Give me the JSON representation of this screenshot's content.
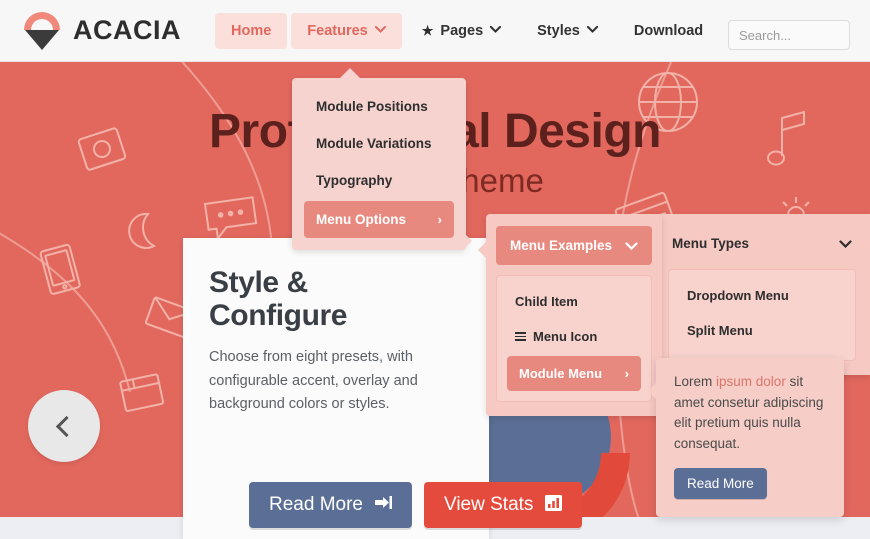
{
  "brand": {
    "name": "ACACIA",
    "logo_icon": "acacia-logo-icon"
  },
  "nav": {
    "items": [
      {
        "label": "Home",
        "icon": null,
        "caret": false,
        "highlight": true
      },
      {
        "label": "Features",
        "icon": null,
        "caret": true,
        "highlight": true
      },
      {
        "label": "Pages",
        "icon": "star-icon",
        "caret": true,
        "highlight": false
      },
      {
        "label": "Styles",
        "icon": null,
        "caret": true,
        "highlight": false
      },
      {
        "label": "Download",
        "icon": null,
        "caret": false,
        "highlight": false
      }
    ],
    "caret_glyph": "❯"
  },
  "search": {
    "placeholder": "Search...",
    "value": ""
  },
  "hero": {
    "title": "Professional Design",
    "subtitle": "Joomla Theme",
    "background_color": "#e2685e",
    "title_color": "#5c211c",
    "prev_arrow_label": "Previous slide",
    "deco_icons": [
      "camera-icon",
      "moon-icon",
      "tablet-icon",
      "chat-bubble-icon",
      "envelope-icon",
      "globe-icon",
      "music-note-icon",
      "sun-icon",
      "credit-card-icon",
      "box-icon"
    ]
  },
  "card": {
    "heading_line1": "Style &",
    "heading_line2": "Configure",
    "body": "Choose from eight presets, with configurable accent, overlay and background colors or styles."
  },
  "hero_buttons": [
    {
      "label": "Read More",
      "icon": "sign-in-icon",
      "glyph": "⮕",
      "color": "#5b6f96"
    },
    {
      "label": "View Stats",
      "icon": "bar-chart-icon",
      "glyph": "Ὄa",
      "color": "#e54b3c"
    }
  ],
  "features_dropdown": {
    "items": [
      {
        "label": "Module Positions",
        "active": false,
        "chevron": false
      },
      {
        "label": "Module Variations",
        "active": false,
        "chevron": false
      },
      {
        "label": "Typography",
        "active": false,
        "chevron": false
      },
      {
        "label": "Menu Options",
        "active": true,
        "chevron": true
      }
    ],
    "chevron_glyph": "›"
  },
  "menu_examples_panel": {
    "header": {
      "label": "Menu Examples",
      "caret": "❯"
    },
    "items": [
      {
        "label": "Child Item",
        "icon": null,
        "active": false,
        "chevron": false
      },
      {
        "label": "Menu Icon",
        "icon": "hamburger-icon",
        "active": false,
        "chevron": false
      },
      {
        "label": "Module Menu",
        "icon": null,
        "active": true,
        "chevron": true
      }
    ],
    "chevron_glyph": "›"
  },
  "menu_types_panel": {
    "header": {
      "label": "Menu Types",
      "caret": "❯"
    },
    "items": [
      {
        "label": "Dropdown Menu"
      },
      {
        "label": "Split Menu"
      }
    ]
  },
  "module_flyout": {
    "text_before": "Lorem ",
    "text_highlight": "ipsum dolor",
    "text_after": " sit amet consetur adipiscing elit pretium quis nulla consequat.",
    "button_label": "Read More",
    "button_color": "#5b6f96"
  },
  "colors": {
    "accent": "#e2685e",
    "accent_dark": "#5c211c",
    "panel_pink": "#f6d3ce",
    "panel_pink_deep": "#f7c9c3",
    "item_active": "#e8897f",
    "blue": "#5b6f96",
    "red": "#e54b3c",
    "topbar": "#f7f7f7",
    "page_bottom": "#eceef4"
  }
}
